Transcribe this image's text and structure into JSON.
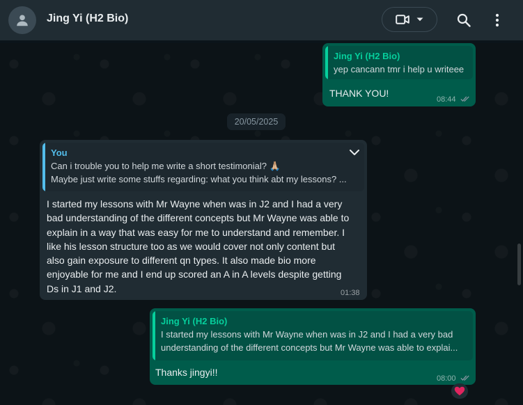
{
  "header": {
    "contact_name": "Jing Yi (H2 Bio)"
  },
  "icons": {
    "avatar": "person-icon",
    "video": "video-call-icon",
    "dropdown": "chevron-down-icon",
    "search": "search-icon",
    "menu": "kebab-menu-icon"
  },
  "messages": [
    {
      "direction": "outgoing",
      "quote_author": "Jing Yi (H2 Bio)",
      "quote_lines": [
        "yep cancann tmr i help u writeee"
      ],
      "text": "THANK YOU!",
      "time": "08:44",
      "status": "read"
    },
    {
      "direction": "incoming",
      "quote_author": "You",
      "quote_lines": [
        "Can i trouble you to help me write a short testimonial? 🙏🏼",
        "Maybe just write some stuffs regarding: what you think abt my lessons? ..."
      ],
      "text_lines": [
        "I started my lessons with Mr Wayne when was in J2 and I had a very",
        "bad understanding of the different concepts but Mr Wayne was able to",
        "explain in a way that was easy for me to understand and remember. I",
        "like his lesson structure too as we would cover not only content but",
        "also gain exposure to different qn types. It also made bio more",
        "enjoyable for me and I end up scored an A in A levels despite getting",
        "Ds in J1 and J2."
      ],
      "time": "01:38"
    },
    {
      "direction": "outgoing",
      "quote_author": "Jing Yi (H2 Bio)",
      "quote_lines": [
        "I started my lessons with Mr Wayne when was in J2 and I had a very bad",
        "understanding of the different concepts but Mr Wayne was able to explai..."
      ],
      "text": "Thanks jingyi!!",
      "time": "08:00",
      "status": "read",
      "reaction": "❤️"
    }
  ],
  "date_separator": "20/05/2025",
  "colors": {
    "outgoing_bubble": "#005c4b",
    "incoming_bubble": "#202c33",
    "outgoing_quote_accent": "#06cf9c",
    "incoming_quote_accent": "#53bdeb",
    "header_bg": "#202c33"
  }
}
